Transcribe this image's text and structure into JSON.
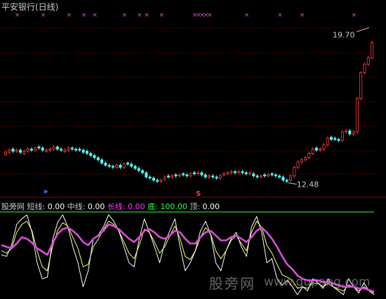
{
  "title": "平安银行(日线)",
  "markers": {
    "x_label": "×",
    "s_label": "S"
  },
  "price_labels": {
    "high": "19.70",
    "low": "12.48"
  },
  "indicator": {
    "name": "股旁网",
    "items": [
      {
        "label": "短线:",
        "value": "0.00",
        "color": "#ffffff"
      },
      {
        "label": "中线:",
        "value": "0.00",
        "color": "#ffff66"
      },
      {
        "label": "长线:",
        "value": "0.00",
        "color": "#ff33ff"
      },
      {
        "label": "底:",
        "value": "100.00",
        "color": "#33ff33"
      },
      {
        "label": "顶:",
        "value": "0.00",
        "color": "#ffffff"
      }
    ]
  },
  "watermark": {
    "cn": "股旁网",
    "url": "www.gupang.com"
  },
  "colors": {
    "up": "#ff3c3c",
    "down": "#54fcfc",
    "grid": "#8b0000",
    "short": "#ffffff",
    "mid": "#ffff66",
    "long": "#d94cd9",
    "bottom": "#33ff33",
    "x_marker": "#d94cd9"
  },
  "chart_data": {
    "type": "candlestick",
    "price_high": 19.7,
    "price_low": 12.48,
    "closes": [
      13.9,
      14.0,
      13.95,
      14.0,
      13.9,
      13.95,
      14.05,
      14.0,
      14.1,
      14.1,
      14.0,
      14.0,
      14.05,
      14.15,
      14.05,
      14.0,
      14.0,
      14.1,
      14.05,
      14.0,
      14.0,
      13.9,
      13.85,
      13.75,
      13.65,
      13.55,
      13.4,
      13.3,
      13.25,
      13.2,
      13.3,
      13.2,
      13.35,
      13.35,
      13.25,
      13.15,
      13.05,
      12.95,
      12.75,
      12.7,
      12.6,
      12.55,
      12.6,
      12.75,
      12.75,
      12.8,
      12.8,
      12.85,
      12.85,
      12.8,
      12.9,
      12.9,
      12.95,
      12.85,
      12.75,
      12.8,
      12.75,
      12.7,
      12.8,
      12.9,
      12.95,
      13.0,
      12.95,
      13.0,
      12.95,
      12.9,
      12.95,
      12.8,
      12.75,
      12.8,
      12.8,
      12.85,
      12.85,
      12.8,
      12.75,
      12.6,
      12.55,
      12.8,
      13.2,
      13.45,
      13.55,
      13.65,
      13.85,
      14.05,
      14.0,
      14.05,
      14.25,
      14.55,
      14.5,
      14.5,
      14.45,
      14.85,
      14.9,
      14.75,
      14.85,
      16.4,
      17.6,
      18.0,
      18.3,
      19.0
    ],
    "opens": [
      13.8,
      13.9,
      14.05,
      13.95,
      14.0,
      13.85,
      13.95,
      14.05,
      14.0,
      14.15,
      14.1,
      13.95,
      14.0,
      14.05,
      14.15,
      14.05,
      13.95,
      14.0,
      14.1,
      14.05,
      14.05,
      14.0,
      13.95,
      13.85,
      13.75,
      13.65,
      13.55,
      13.4,
      13.3,
      13.25,
      13.2,
      13.3,
      13.2,
      13.4,
      13.35,
      13.25,
      13.15,
      13.05,
      12.95,
      12.75,
      12.7,
      12.6,
      12.55,
      12.65,
      12.8,
      12.75,
      12.85,
      12.8,
      12.9,
      12.85,
      12.8,
      12.95,
      12.9,
      12.95,
      12.85,
      12.75,
      12.8,
      12.75,
      12.7,
      12.85,
      12.9,
      12.95,
      13.0,
      12.95,
      13.0,
      12.95,
      12.9,
      12.9,
      12.8,
      12.75,
      12.85,
      12.8,
      12.9,
      12.85,
      12.8,
      12.75,
      12.6,
      12.6,
      12.8,
      13.2,
      13.45,
      13.55,
      13.65,
      13.85,
      14.1,
      14.0,
      14.05,
      14.25,
      14.6,
      14.55,
      14.5,
      14.45,
      14.85,
      14.9,
      14.75,
      14.85,
      16.4,
      17.6,
      18.0,
      18.3
    ],
    "x_marker_bars": [
      3,
      10,
      17,
      21,
      24,
      32,
      36,
      38,
      42,
      51,
      52,
      53,
      54,
      55,
      65,
      74,
      80,
      94
    ],
    "s_marker_bar": 52,
    "red_triangle_bar": 11,
    "short_line": [
      50,
      48,
      62,
      88,
      95,
      100,
      78,
      40,
      20,
      22,
      68,
      90,
      100,
      85,
      60,
      40,
      10,
      30,
      70,
      75,
      85,
      100,
      92,
      80,
      60,
      40,
      35,
      70,
      95,
      78,
      60,
      40,
      65,
      80,
      95,
      60,
      30,
      40,
      55,
      80,
      92,
      75,
      40,
      30,
      55,
      70,
      78,
      60,
      48,
      85,
      98,
      78,
      40,
      45,
      20,
      12,
      18,
      10,
      0,
      10,
      5,
      20,
      15,
      8,
      20,
      10,
      5,
      0,
      20,
      10,
      2,
      15,
      5,
      0
    ],
    "mid_line": [
      55,
      52,
      58,
      78,
      88,
      92,
      80,
      55,
      35,
      30,
      60,
      80,
      90,
      86,
      72,
      58,
      35,
      38,
      60,
      70,
      82,
      92,
      88,
      80,
      66,
      52,
      45,
      62,
      82,
      78,
      66,
      52,
      60,
      74,
      86,
      70,
      48,
      44,
      55,
      72,
      84,
      76,
      55,
      45,
      55,
      68,
      74,
      64,
      55,
      78,
      92,
      84,
      62,
      52,
      38,
      25,
      22,
      18,
      8,
      10,
      8,
      15,
      14,
      10,
      14,
      10,
      7,
      5,
      12,
      10,
      5,
      10,
      6,
      2
    ],
    "long_line": [
      62,
      60,
      58,
      64,
      72,
      70,
      65,
      58,
      54,
      50,
      64,
      76,
      82,
      84,
      80,
      74,
      66,
      62,
      70,
      74,
      80,
      88,
      86,
      82,
      76,
      70,
      66,
      72,
      80,
      82,
      78,
      72,
      70,
      74,
      80,
      78,
      70,
      64,
      64,
      72,
      78,
      80,
      74,
      68,
      68,
      72,
      74,
      70,
      66,
      72,
      80,
      84,
      78,
      70,
      60,
      48,
      38,
      32,
      24,
      20,
      18,
      18,
      18,
      16,
      16,
      14,
      12,
      10,
      10,
      10,
      8,
      8,
      6,
      4
    ]
  }
}
